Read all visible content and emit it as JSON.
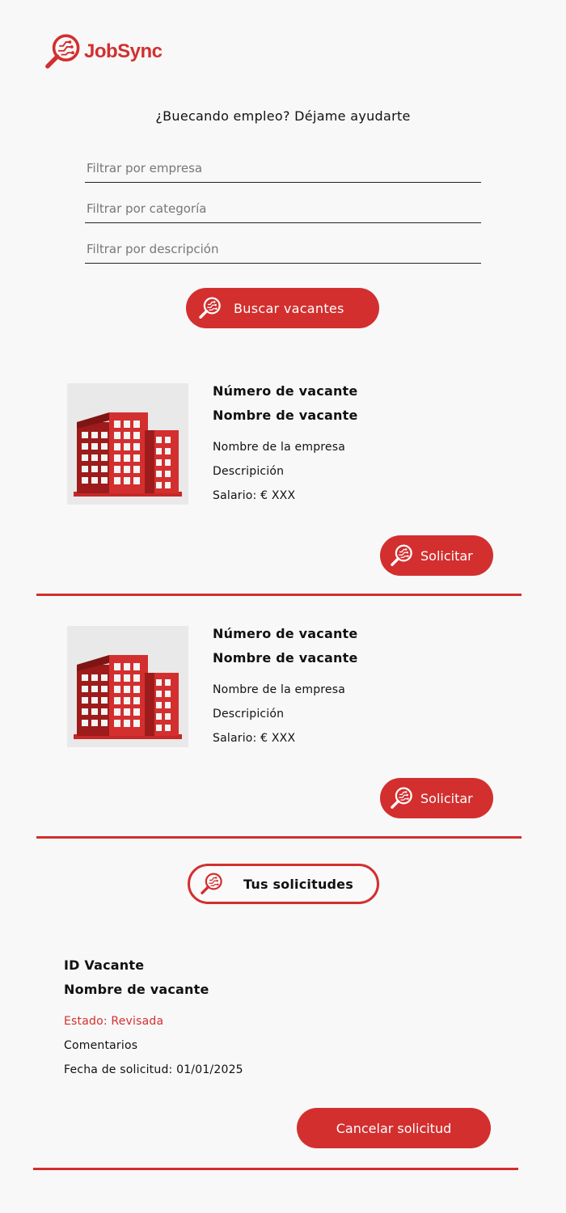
{
  "brand": {
    "name": "JobSync",
    "icon": "magnifier-circuit-icon",
    "accent": "#d32f2f"
  },
  "search": {
    "headline": "¿Buecando empleo? Déjame ayudarte",
    "company_placeholder": "Filtrar por empresa",
    "category_placeholder": "Filtrar por categoría",
    "description_placeholder": "Filtrar por descripción",
    "button_label": "Buscar vacantes"
  },
  "vacancies": [
    {
      "image": "building-icon",
      "number": "Número de vacante",
      "name": "Nombre de vacante",
      "company": "Nombre de la empresa",
      "description": "Descripición",
      "salary": "Salario: € XXX",
      "apply_label": "Solicitar"
    },
    {
      "image": "building-icon",
      "number": "Número de vacante",
      "name": "Nombre de vacante",
      "company": "Nombre de la empresa",
      "description": "Descripición",
      "salary": "Salario: € XXX",
      "apply_label": "Solicitar"
    }
  ],
  "applications_button": "Tus solicitudes",
  "application": {
    "id": "ID Vacante",
    "name": "Nombre de vacante",
    "status": "Estado: Revisada",
    "comments": "Comentarios",
    "date": "Fecha de solicitud: 01/01/2025",
    "cancel_label": "Cancelar solicitud"
  }
}
